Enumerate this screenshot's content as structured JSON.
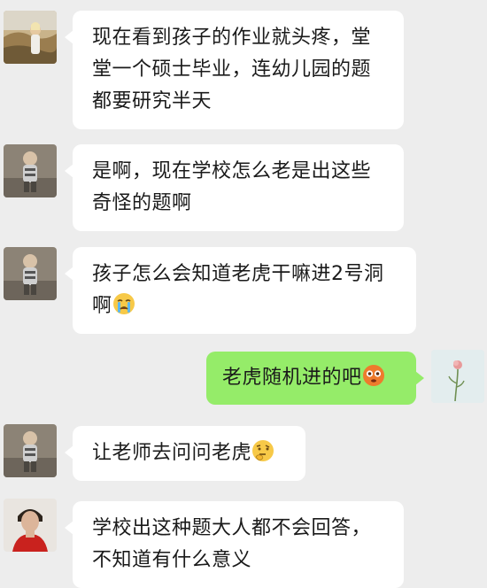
{
  "messages": [
    {
      "text": "现在看到孩子的作业就头疼，堂堂一个硕士毕业，连幼儿园的题都要研究半天",
      "emoji": ""
    },
    {
      "text": "是啊，现在学校怎么老是出这些奇怪的题啊",
      "emoji": ""
    },
    {
      "text": "孩子怎么会知道老虎干嘛进2号洞啊",
      "emoji": "crying-face"
    },
    {
      "text": "老虎随机进的吧",
      "emoji": "flushed-face"
    },
    {
      "text": "让老师去问问老虎",
      "emoji": "thinking-face"
    },
    {
      "text": "学校出这种题大人都不会回答，不知道有什么意义",
      "emoji": ""
    }
  ],
  "colors": {
    "background": "#ededed",
    "incoming_bubble": "#ffffff",
    "outgoing_bubble": "#95ec69"
  }
}
